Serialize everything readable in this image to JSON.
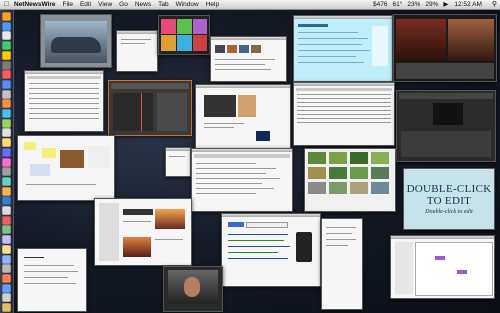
{
  "menubar": {
    "apple_icon": "apple-logo-icon",
    "app_name": "NetNewsWire",
    "menus": [
      "File",
      "Edit",
      "View",
      "Go",
      "News",
      "Tab",
      "Window",
      "Help"
    ],
    "status": {
      "stock": "$476",
      "temperature": "61°",
      "cpu": "23%",
      "battery": "29%",
      "clock": "12:52 AM"
    }
  },
  "dock": {
    "icon_colors": [
      "#ff9f1c",
      "#4b9bff",
      "#e9e9e9",
      "#3bd16f",
      "#ffcc00",
      "#7d7d7d",
      "#ff5a5a",
      "#5a8dff",
      "#c3c3c3",
      "#ff8c3b",
      "#45c0ff",
      "#9bd65a",
      "#e0e0e0",
      "#ffdb6e",
      "#6a6aff",
      "#ff6ad5",
      "#a0a0a0",
      "#5fd3c6",
      "#ffaf45",
      "#3a7bd5",
      "#dddddd",
      "#f06060",
      "#80c080",
      "#c0c0ff",
      "#ffe08a",
      "#8ab4ff",
      "#bbbbbb",
      "#ff7f50",
      "#60a0ff",
      "#d0d0d0",
      "#e8c060"
    ]
  },
  "slide_window": {
    "title": "DOUBLE-CLICK TO EDIT",
    "subtitle": "Double-click to edit"
  },
  "brand_colors": {
    "desktop": "#151b27",
    "menubar": "#e4e4e4",
    "slide_bg": "#c6e3ea",
    "greeting_card": "#bfeefb"
  }
}
